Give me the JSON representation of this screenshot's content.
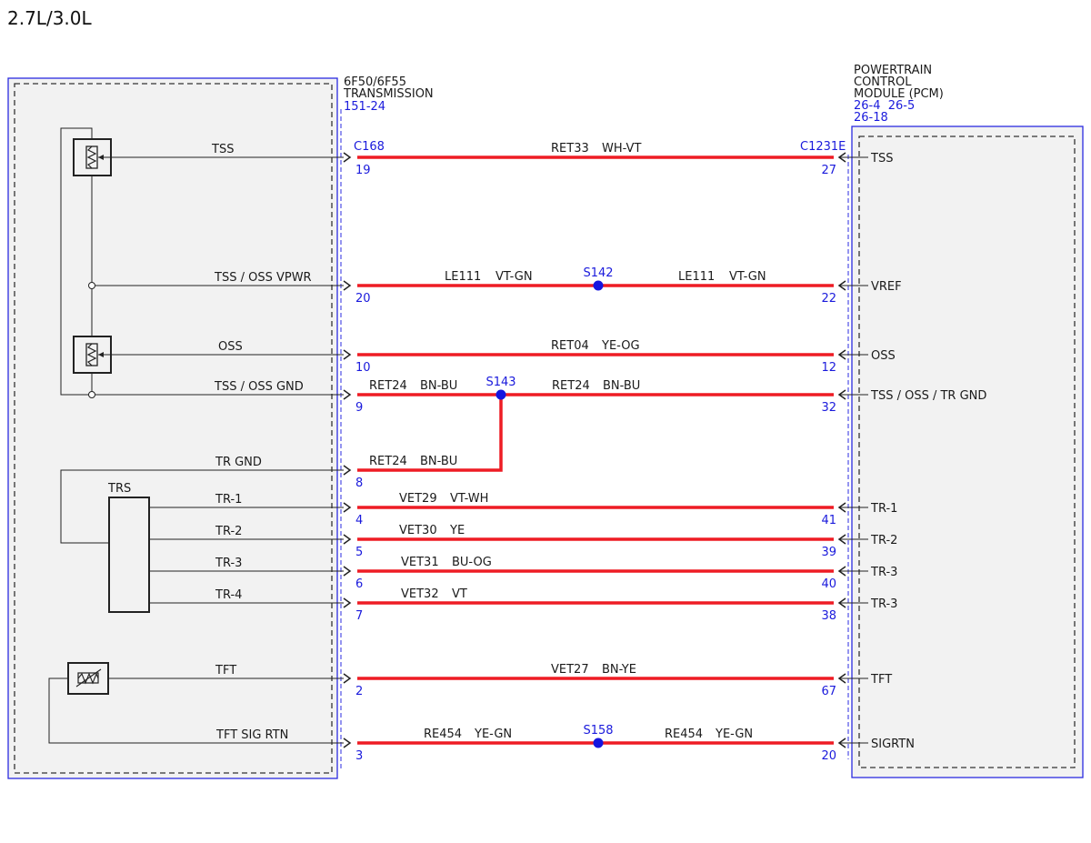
{
  "title": "2.7L/3.0L",
  "transmission": {
    "name_lines": [
      "6F50/6F55",
      "TRANSMISSION"
    ],
    "ref": "151-24",
    "connector": "C168"
  },
  "pcm": {
    "name_lines": [
      "POWERTRAIN",
      "CONTROL",
      "MODULE (PCM)"
    ],
    "refs": [
      "26-4  26-5",
      "26-18"
    ],
    "connector": "C1231E"
  },
  "components": {
    "trs_label": "TRS"
  },
  "colors": {
    "wire": "#ee1c24",
    "splice": "#1515e0",
    "frame_blue": "#2b2be0",
    "pin_text": "#1a1adc"
  },
  "circuits": [
    {
      "id": "tss",
      "left_label": "TSS",
      "left_pin": "19",
      "right_pin": "27",
      "right_label": "TSS",
      "segments": [
        {
          "circuit": "RET33",
          "color": "WH-VT"
        }
      ]
    },
    {
      "id": "vpwr",
      "left_label": "TSS / OSS VPWR",
      "left_pin": "20",
      "right_pin": "22",
      "right_label": "VREF",
      "splice": "S142",
      "segments": [
        {
          "circuit": "LE111",
          "color": "VT-GN"
        },
        {
          "circuit": "LE111",
          "color": "VT-GN"
        }
      ]
    },
    {
      "id": "oss",
      "left_label": "OSS",
      "left_pin": "10",
      "right_pin": "12",
      "right_label": "OSS",
      "segments": [
        {
          "circuit": "RET04",
          "color": "YE-OG"
        }
      ]
    },
    {
      "id": "gnd",
      "left_label": "TSS / OSS GND",
      "left_pin": "9",
      "right_pin": "32",
      "right_label": "TSS / OSS / TR GND",
      "splice": "S143",
      "segments": [
        {
          "circuit": "RET24",
          "color": "BN-BU"
        },
        {
          "circuit": "RET24",
          "color": "BN-BU"
        }
      ]
    },
    {
      "id": "trgnd",
      "left_label": "TR GND",
      "left_pin": "8",
      "segments": [
        {
          "circuit": "RET24",
          "color": "BN-BU"
        }
      ]
    },
    {
      "id": "tr1",
      "left_label": "TR-1",
      "left_pin": "4",
      "right_pin": "41",
      "right_label": "TR-1",
      "segments": [
        {
          "circuit": "VET29",
          "color": "VT-WH"
        }
      ]
    },
    {
      "id": "tr2",
      "left_label": "TR-2",
      "left_pin": "5",
      "right_pin": "39",
      "right_label": "TR-2",
      "segments": [
        {
          "circuit": "VET30",
          "color": "YE"
        }
      ]
    },
    {
      "id": "tr3",
      "left_label": "TR-3",
      "left_pin": "6",
      "right_pin": "40",
      "right_label": "TR-3",
      "segments": [
        {
          "circuit": "VET31",
          "color": "BU-OG"
        }
      ]
    },
    {
      "id": "tr4",
      "left_label": "TR-4",
      "left_pin": "7",
      "right_pin": "38",
      "right_label": "TR-3",
      "segments": [
        {
          "circuit": "VET32",
          "color": "VT"
        }
      ]
    },
    {
      "id": "tft",
      "left_label": "TFT",
      "left_pin": "2",
      "right_pin": "67",
      "right_label": "TFT",
      "segments": [
        {
          "circuit": "VET27",
          "color": "BN-YE"
        }
      ]
    },
    {
      "id": "sigrtn",
      "left_label": "TFT SIG RTN",
      "left_pin": "3",
      "right_pin": "20",
      "right_label": "SIGRTN",
      "splice": "S158",
      "segments": [
        {
          "circuit": "RE454",
          "color": "YE-GN"
        },
        {
          "circuit": "RE454",
          "color": "YE-GN"
        }
      ]
    }
  ]
}
